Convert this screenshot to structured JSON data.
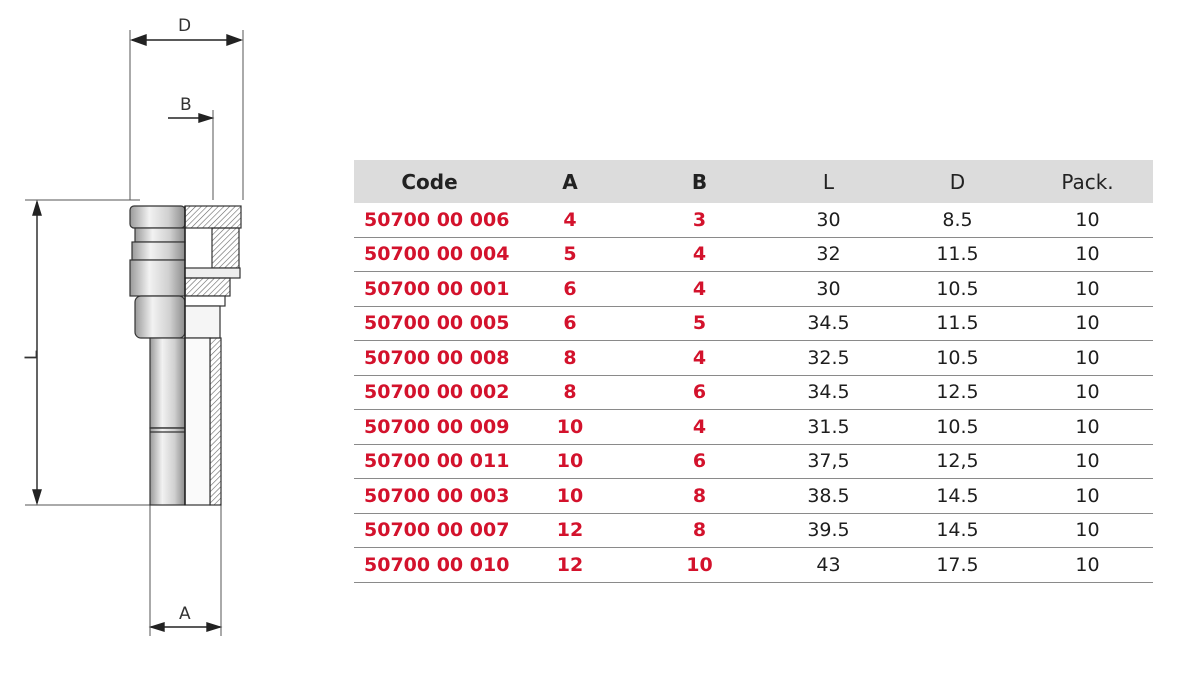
{
  "drawing": {
    "labels": {
      "d": "D",
      "b": "B",
      "l": "L",
      "a": "A"
    }
  },
  "table": {
    "columns": [
      "Code",
      "A",
      "B",
      "L",
      "D",
      "Pack."
    ],
    "rows": [
      [
        "50700 00 006",
        "4",
        "3",
        "30",
        "8.5",
        "10"
      ],
      [
        "50700 00 004",
        "5",
        "4",
        "32",
        "11.5",
        "10"
      ],
      [
        "50700 00 001",
        "6",
        "4",
        "30",
        "10.5",
        "10"
      ],
      [
        "50700 00 005",
        "6",
        "5",
        "34.5",
        "11.5",
        "10"
      ],
      [
        "50700 00 008",
        "8",
        "4",
        "32.5",
        "10.5",
        "10"
      ],
      [
        "50700 00 002",
        "8",
        "6",
        "34.5",
        "12.5",
        "10"
      ],
      [
        "50700 00 009",
        "10",
        "4",
        "31.5",
        "10.5",
        "10"
      ],
      [
        "50700 00 011",
        "10",
        "6",
        "37,5",
        "12,5",
        "10"
      ],
      [
        "50700 00 003",
        "10",
        "8",
        "38.5",
        "14.5",
        "10"
      ],
      [
        "50700 00 007",
        "12",
        "8",
        "39.5",
        "14.5",
        "10"
      ],
      [
        "50700 00 010",
        "12",
        "10",
        "43",
        "17.5",
        "10"
      ]
    ]
  },
  "colors": {
    "highlight": "#d3122c",
    "header_bg": "#dcdcdc",
    "text": "#1e1e1e"
  }
}
